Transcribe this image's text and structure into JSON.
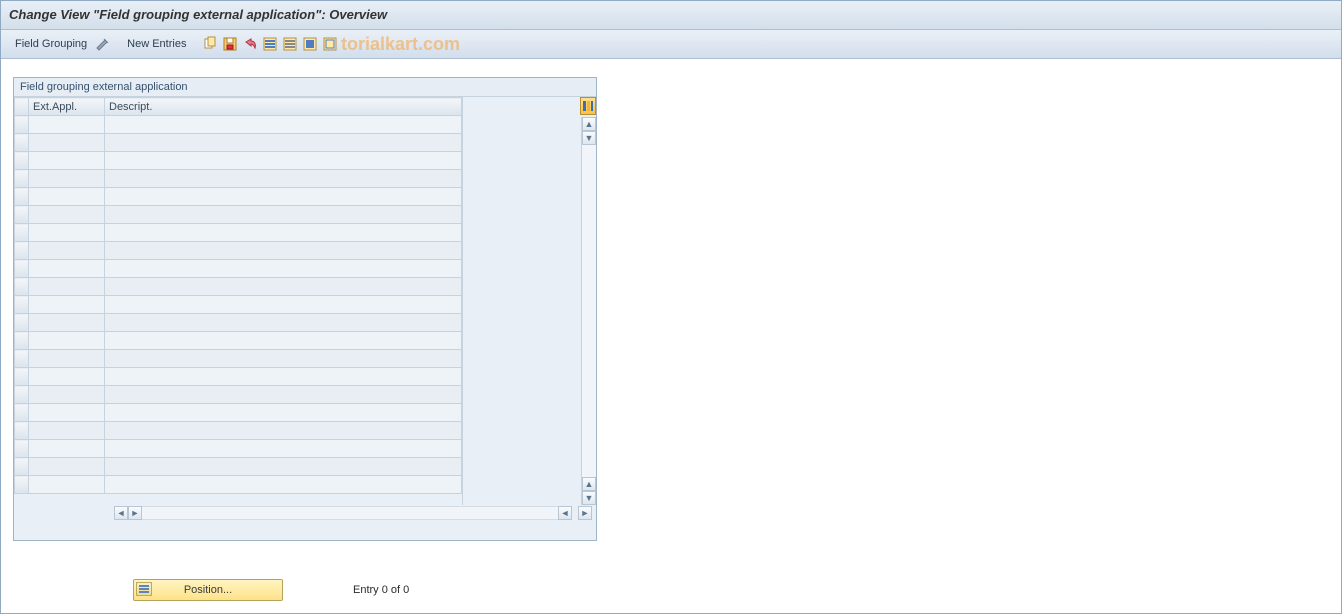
{
  "title": "Change View \"Field grouping external application\": Overview",
  "toolbar": {
    "field_grouping_label": "Field Grouping",
    "new_entries_label": "New Entries"
  },
  "watermark": "torialkart.com",
  "panel": {
    "title": "Field grouping external application",
    "columns": {
      "sel": "",
      "ext_appl": "Ext.Appl.",
      "descript": "Descript."
    },
    "rows": [
      {
        "ext": "",
        "desc": ""
      },
      {
        "ext": "",
        "desc": ""
      },
      {
        "ext": "",
        "desc": ""
      },
      {
        "ext": "",
        "desc": ""
      },
      {
        "ext": "",
        "desc": ""
      },
      {
        "ext": "",
        "desc": ""
      },
      {
        "ext": "",
        "desc": ""
      },
      {
        "ext": "",
        "desc": ""
      },
      {
        "ext": "",
        "desc": ""
      },
      {
        "ext": "",
        "desc": ""
      },
      {
        "ext": "",
        "desc": ""
      },
      {
        "ext": "",
        "desc": ""
      },
      {
        "ext": "",
        "desc": ""
      },
      {
        "ext": "",
        "desc": ""
      },
      {
        "ext": "",
        "desc": ""
      },
      {
        "ext": "",
        "desc": ""
      },
      {
        "ext": "",
        "desc": ""
      },
      {
        "ext": "",
        "desc": ""
      },
      {
        "ext": "",
        "desc": ""
      },
      {
        "ext": "",
        "desc": ""
      },
      {
        "ext": "",
        "desc": ""
      }
    ]
  },
  "status": {
    "position_label": "Position...",
    "entry_label": "Entry 0 of 0"
  }
}
